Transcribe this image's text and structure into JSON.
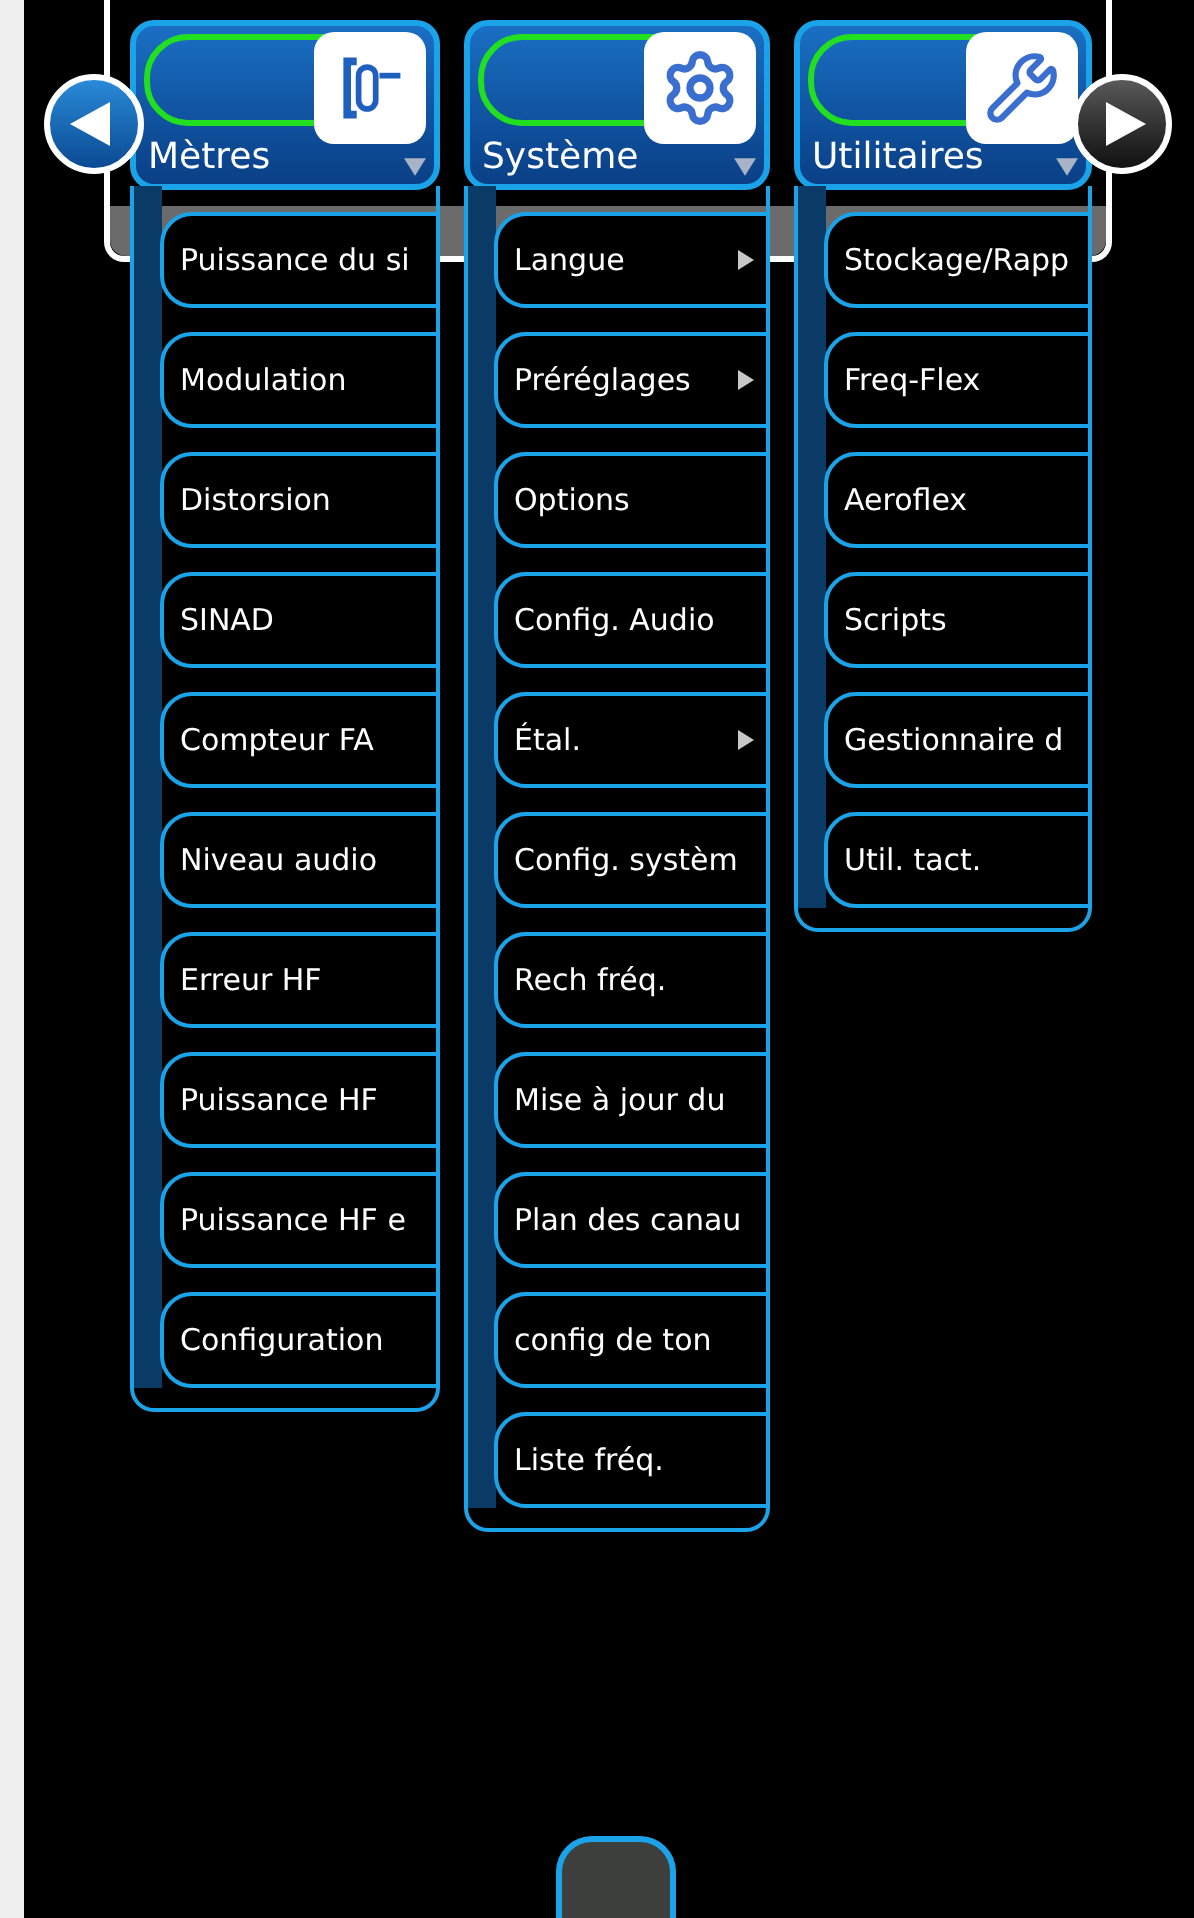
{
  "menus": [
    {
      "title": "Mètres",
      "items": [
        {
          "label": "Puissance du si",
          "submenu": false
        },
        {
          "label": "Modulation",
          "submenu": false
        },
        {
          "label": "Distorsion",
          "submenu": false
        },
        {
          "label": "SINAD",
          "submenu": false
        },
        {
          "label": "Compteur FA",
          "submenu": false
        },
        {
          "label": "Niveau audio",
          "submenu": false
        },
        {
          "label": "Erreur HF",
          "submenu": false
        },
        {
          "label": "Puissance HF",
          "submenu": false
        },
        {
          "label": "Puissance HF e",
          "submenu": false
        },
        {
          "label": "Configuration",
          "submenu": false
        }
      ]
    },
    {
      "title": "Système",
      "items": [
        {
          "label": "Langue",
          "submenu": true
        },
        {
          "label": "Préréglages",
          "submenu": true
        },
        {
          "label": "Options",
          "submenu": false
        },
        {
          "label": "Config. Audio",
          "submenu": false
        },
        {
          "label": "Étal.",
          "submenu": true
        },
        {
          "label": "Config. systèm",
          "submenu": false
        },
        {
          "label": "Rech fréq.",
          "submenu": false
        },
        {
          "label": "Mise à jour du",
          "submenu": false
        },
        {
          "label": "Plan des canau",
          "submenu": false
        },
        {
          "label": "config de ton",
          "submenu": false
        },
        {
          "label": "Liste fréq.",
          "submenu": false
        }
      ]
    },
    {
      "title": "Utilitaires",
      "items": [
        {
          "label": "Stockage/Rapp",
          "submenu": false
        },
        {
          "label": "Freq-Flex",
          "submenu": false
        },
        {
          "label": "Aeroflex",
          "submenu": false
        },
        {
          "label": "Scripts",
          "submenu": false
        },
        {
          "label": "Gestionnaire d",
          "submenu": false
        },
        {
          "label": "Util. tact.",
          "submenu": false
        }
      ]
    }
  ]
}
